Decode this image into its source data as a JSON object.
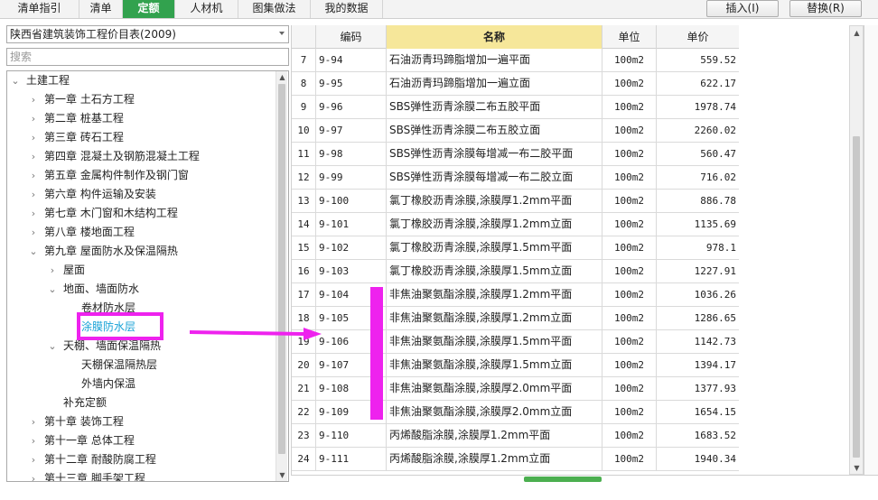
{
  "tabs": [
    {
      "label": "清单指引",
      "active": false
    },
    {
      "label": "清单",
      "active": false
    },
    {
      "label": "定额",
      "active": true
    },
    {
      "label": "人材机",
      "active": false
    },
    {
      "label": "图集做法",
      "active": false
    },
    {
      "label": "我的数据",
      "active": false
    }
  ],
  "toolbar": {
    "insert_label": "插入(I)",
    "replace_label": "替换(R)"
  },
  "left": {
    "dropdown_value": "陕西省建筑装饰工程价目表(2009)",
    "search_placeholder": "搜索",
    "tree": [
      {
        "label": "土建工程",
        "level": 0,
        "expanded": true
      },
      {
        "label": "第一章 土石方工程",
        "level": 1,
        "expanded": false
      },
      {
        "label": "第二章 桩基工程",
        "level": 1,
        "expanded": false
      },
      {
        "label": "第三章 砖石工程",
        "level": 1,
        "expanded": false
      },
      {
        "label": "第四章 混凝土及钢筋混凝土工程",
        "level": 1,
        "expanded": false
      },
      {
        "label": "第五章 金属构件制作及钢门窗",
        "level": 1,
        "expanded": false
      },
      {
        "label": "第六章 构件运输及安装",
        "level": 1,
        "expanded": false
      },
      {
        "label": "第七章 木门窗和木结构工程",
        "level": 1,
        "expanded": false
      },
      {
        "label": "第八章 楼地面工程",
        "level": 1,
        "expanded": false
      },
      {
        "label": "第九章 屋面防水及保温隔热",
        "level": 1,
        "expanded": true
      },
      {
        "label": "屋面",
        "level": 2,
        "expanded": false
      },
      {
        "label": "地面、墙面防水",
        "level": 2,
        "expanded": true
      },
      {
        "label": "卷材防水层",
        "level": 3,
        "leaf": true
      },
      {
        "label": "涂膜防水层",
        "level": 3,
        "leaf": true,
        "selected": true
      },
      {
        "label": "天棚、墙面保温隔热",
        "level": 2,
        "expanded": true
      },
      {
        "label": "天棚保温隔热层",
        "level": 3,
        "leaf": true
      },
      {
        "label": "外墙内保温",
        "level": 3,
        "leaf": true
      },
      {
        "label": "补充定额",
        "level": 2,
        "leaf": true
      },
      {
        "label": "第十章 装饰工程",
        "level": 1,
        "expanded": false
      },
      {
        "label": "第十一章 总体工程",
        "level": 1,
        "expanded": false
      },
      {
        "label": "第十二章 耐酸防腐工程",
        "level": 1,
        "expanded": false
      },
      {
        "label": "第十三章 脚手架工程",
        "level": 1,
        "expanded": false
      }
    ]
  },
  "table": {
    "headers": {
      "num": "",
      "code": "编码",
      "name": "名称",
      "unit": "单位",
      "price": "单价"
    },
    "rows": [
      {
        "num": "7",
        "code": "9-94",
        "name": "石油沥青玛蹄脂增加一遍平面",
        "unit": "100m2",
        "price": "559.52"
      },
      {
        "num": "8",
        "code": "9-95",
        "name": "石油沥青玛蹄脂增加一遍立面",
        "unit": "100m2",
        "price": "622.17"
      },
      {
        "num": "9",
        "code": "9-96",
        "name": "SBS弹性沥青涂膜二布五胶平面",
        "unit": "100m2",
        "price": "1978.74"
      },
      {
        "num": "10",
        "code": "9-97",
        "name": "SBS弹性沥青涂膜二布五胶立面",
        "unit": "100m2",
        "price": "2260.02"
      },
      {
        "num": "11",
        "code": "9-98",
        "name": "SBS弹性沥青涂膜每增减一布二胶平面",
        "unit": "100m2",
        "price": "560.47"
      },
      {
        "num": "12",
        "code": "9-99",
        "name": "SBS弹性沥青涂膜每增减一布二胶立面",
        "unit": "100m2",
        "price": "716.02"
      },
      {
        "num": "13",
        "code": "9-100",
        "name": "氯丁橡胶沥青涂膜,涂膜厚1.2mm平面",
        "unit": "100m2",
        "price": "886.78"
      },
      {
        "num": "14",
        "code": "9-101",
        "name": "氯丁橡胶沥青涂膜,涂膜厚1.2mm立面",
        "unit": "100m2",
        "price": "1135.69"
      },
      {
        "num": "15",
        "code": "9-102",
        "name": "氯丁橡胶沥青涂膜,涂膜厚1.5mm平面",
        "unit": "100m2",
        "price": "978.1"
      },
      {
        "num": "16",
        "code": "9-103",
        "name": "氯丁橡胶沥青涂膜,涂膜厚1.5mm立面",
        "unit": "100m2",
        "price": "1227.91"
      },
      {
        "num": "17",
        "code": "9-104",
        "name": "非焦油聚氨酯涂膜,涂膜厚1.2mm平面",
        "unit": "100m2",
        "price": "1036.26"
      },
      {
        "num": "18",
        "code": "9-105",
        "name": "非焦油聚氨酯涂膜,涂膜厚1.2mm立面",
        "unit": "100m2",
        "price": "1286.65"
      },
      {
        "num": "19",
        "code": "9-106",
        "name": "非焦油聚氨酯涂膜,涂膜厚1.5mm平面",
        "unit": "100m2",
        "price": "1142.73"
      },
      {
        "num": "20",
        "code": "9-107",
        "name": "非焦油聚氨酯涂膜,涂膜厚1.5mm立面",
        "unit": "100m2",
        "price": "1394.17"
      },
      {
        "num": "21",
        "code": "9-108",
        "name": "非焦油聚氨酯涂膜,涂膜厚2.0mm平面",
        "unit": "100m2",
        "price": "1377.93"
      },
      {
        "num": "22",
        "code": "9-109",
        "name": "非焦油聚氨酯涂膜,涂膜厚2.0mm立面",
        "unit": "100m2",
        "price": "1654.15"
      },
      {
        "num": "23",
        "code": "9-110",
        "name": "丙烯酸脂涂膜,涂膜厚1.2mm平面",
        "unit": "100m2",
        "price": "1683.52"
      },
      {
        "num": "24",
        "code": "9-111",
        "name": "丙烯酸脂涂膜,涂膜厚1.2mm立面",
        "unit": "100m2",
        "price": "1940.34"
      }
    ]
  },
  "annotation_color": "#ee22ee",
  "accent_color": "#32a24e",
  "header_highlight_color": "#f6e79a",
  "selected_text_color": "#18a2d6"
}
